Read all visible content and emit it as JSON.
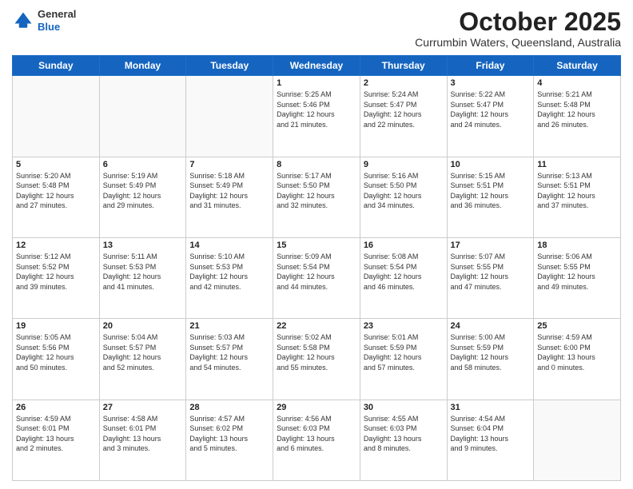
{
  "header": {
    "logo_general": "General",
    "logo_blue": "Blue",
    "month_title": "October 2025",
    "location": "Currumbin Waters, Queensland, Australia"
  },
  "weekdays": [
    "Sunday",
    "Monday",
    "Tuesday",
    "Wednesday",
    "Thursday",
    "Friday",
    "Saturday"
  ],
  "weeks": [
    [
      {
        "day": "",
        "content": ""
      },
      {
        "day": "",
        "content": ""
      },
      {
        "day": "",
        "content": ""
      },
      {
        "day": "1",
        "content": "Sunrise: 5:25 AM\nSunset: 5:46 PM\nDaylight: 12 hours\nand 21 minutes."
      },
      {
        "day": "2",
        "content": "Sunrise: 5:24 AM\nSunset: 5:47 PM\nDaylight: 12 hours\nand 22 minutes."
      },
      {
        "day": "3",
        "content": "Sunrise: 5:22 AM\nSunset: 5:47 PM\nDaylight: 12 hours\nand 24 minutes."
      },
      {
        "day": "4",
        "content": "Sunrise: 5:21 AM\nSunset: 5:48 PM\nDaylight: 12 hours\nand 26 minutes."
      }
    ],
    [
      {
        "day": "5",
        "content": "Sunrise: 5:20 AM\nSunset: 5:48 PM\nDaylight: 12 hours\nand 27 minutes."
      },
      {
        "day": "6",
        "content": "Sunrise: 5:19 AM\nSunset: 5:49 PM\nDaylight: 12 hours\nand 29 minutes."
      },
      {
        "day": "7",
        "content": "Sunrise: 5:18 AM\nSunset: 5:49 PM\nDaylight: 12 hours\nand 31 minutes."
      },
      {
        "day": "8",
        "content": "Sunrise: 5:17 AM\nSunset: 5:50 PM\nDaylight: 12 hours\nand 32 minutes."
      },
      {
        "day": "9",
        "content": "Sunrise: 5:16 AM\nSunset: 5:50 PM\nDaylight: 12 hours\nand 34 minutes."
      },
      {
        "day": "10",
        "content": "Sunrise: 5:15 AM\nSunset: 5:51 PM\nDaylight: 12 hours\nand 36 minutes."
      },
      {
        "day": "11",
        "content": "Sunrise: 5:13 AM\nSunset: 5:51 PM\nDaylight: 12 hours\nand 37 minutes."
      }
    ],
    [
      {
        "day": "12",
        "content": "Sunrise: 5:12 AM\nSunset: 5:52 PM\nDaylight: 12 hours\nand 39 minutes."
      },
      {
        "day": "13",
        "content": "Sunrise: 5:11 AM\nSunset: 5:53 PM\nDaylight: 12 hours\nand 41 minutes."
      },
      {
        "day": "14",
        "content": "Sunrise: 5:10 AM\nSunset: 5:53 PM\nDaylight: 12 hours\nand 42 minutes."
      },
      {
        "day": "15",
        "content": "Sunrise: 5:09 AM\nSunset: 5:54 PM\nDaylight: 12 hours\nand 44 minutes."
      },
      {
        "day": "16",
        "content": "Sunrise: 5:08 AM\nSunset: 5:54 PM\nDaylight: 12 hours\nand 46 minutes."
      },
      {
        "day": "17",
        "content": "Sunrise: 5:07 AM\nSunset: 5:55 PM\nDaylight: 12 hours\nand 47 minutes."
      },
      {
        "day": "18",
        "content": "Sunrise: 5:06 AM\nSunset: 5:55 PM\nDaylight: 12 hours\nand 49 minutes."
      }
    ],
    [
      {
        "day": "19",
        "content": "Sunrise: 5:05 AM\nSunset: 5:56 PM\nDaylight: 12 hours\nand 50 minutes."
      },
      {
        "day": "20",
        "content": "Sunrise: 5:04 AM\nSunset: 5:57 PM\nDaylight: 12 hours\nand 52 minutes."
      },
      {
        "day": "21",
        "content": "Sunrise: 5:03 AM\nSunset: 5:57 PM\nDaylight: 12 hours\nand 54 minutes."
      },
      {
        "day": "22",
        "content": "Sunrise: 5:02 AM\nSunset: 5:58 PM\nDaylight: 12 hours\nand 55 minutes."
      },
      {
        "day": "23",
        "content": "Sunrise: 5:01 AM\nSunset: 5:59 PM\nDaylight: 12 hours\nand 57 minutes."
      },
      {
        "day": "24",
        "content": "Sunrise: 5:00 AM\nSunset: 5:59 PM\nDaylight: 12 hours\nand 58 minutes."
      },
      {
        "day": "25",
        "content": "Sunrise: 4:59 AM\nSunset: 6:00 PM\nDaylight: 13 hours\nand 0 minutes."
      }
    ],
    [
      {
        "day": "26",
        "content": "Sunrise: 4:59 AM\nSunset: 6:01 PM\nDaylight: 13 hours\nand 2 minutes."
      },
      {
        "day": "27",
        "content": "Sunrise: 4:58 AM\nSunset: 6:01 PM\nDaylight: 13 hours\nand 3 minutes."
      },
      {
        "day": "28",
        "content": "Sunrise: 4:57 AM\nSunset: 6:02 PM\nDaylight: 13 hours\nand 5 minutes."
      },
      {
        "day": "29",
        "content": "Sunrise: 4:56 AM\nSunset: 6:03 PM\nDaylight: 13 hours\nand 6 minutes."
      },
      {
        "day": "30",
        "content": "Sunrise: 4:55 AM\nSunset: 6:03 PM\nDaylight: 13 hours\nand 8 minutes."
      },
      {
        "day": "31",
        "content": "Sunrise: 4:54 AM\nSunset: 6:04 PM\nDaylight: 13 hours\nand 9 minutes."
      },
      {
        "day": "",
        "content": ""
      }
    ]
  ]
}
